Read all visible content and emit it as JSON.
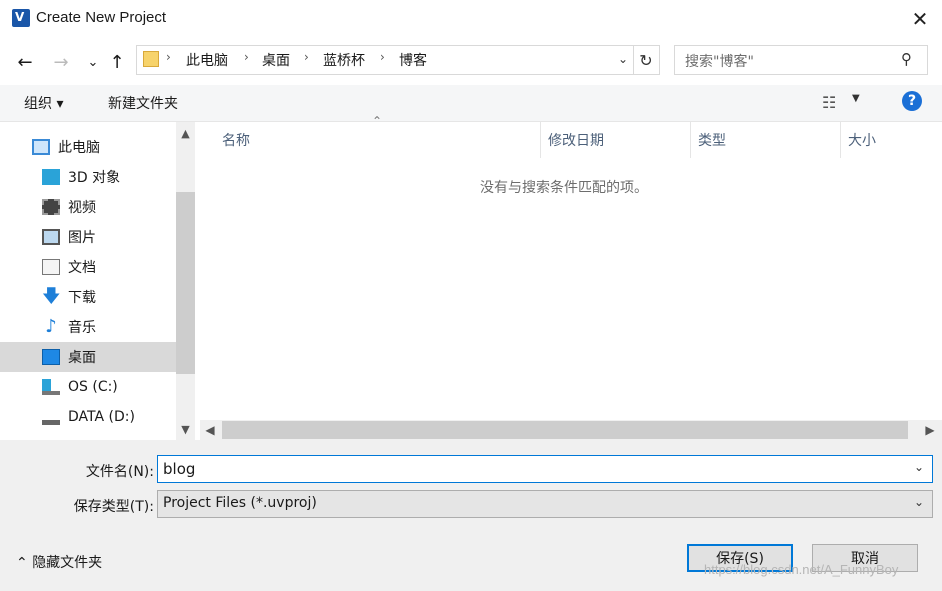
{
  "window": {
    "title": "Create New Project",
    "close": "✕"
  },
  "nav": {
    "back": "←",
    "forward": "→",
    "recent": "⌄",
    "up": "↑",
    "breadcrumb": [
      "此电脑",
      "桌面",
      "蓝桥杯",
      "博客"
    ],
    "search_placeholder": "搜索\"博客\""
  },
  "toolbar": {
    "organize": "组织 ▾",
    "new_folder": "新建文件夹",
    "help": "?"
  },
  "tree": [
    {
      "label": "此电脑",
      "icon": "computer-icon"
    },
    {
      "label": "3D 对象",
      "icon": "3d-objects-icon"
    },
    {
      "label": "视频",
      "icon": "videos-icon"
    },
    {
      "label": "图片",
      "icon": "pictures-icon"
    },
    {
      "label": "文档",
      "icon": "documents-icon"
    },
    {
      "label": "下载",
      "icon": "downloads-icon"
    },
    {
      "label": "音乐",
      "icon": "music-icon"
    },
    {
      "label": "桌面",
      "icon": "desktop-icon",
      "selected": true
    },
    {
      "label": "OS (C:)",
      "icon": "windows-drive-icon"
    },
    {
      "label": "DATA (D:)",
      "icon": "drive-icon"
    }
  ],
  "columns": [
    "名称",
    "修改日期",
    "类型",
    "大小"
  ],
  "empty_message": "没有与搜索条件匹配的项。",
  "form": {
    "filename_label": "文件名(N):",
    "filename_value": "blog",
    "filetype_label": "保存类型(T):",
    "filetype_value": "Project Files (*.uvproj)"
  },
  "footer": {
    "hide_folders": "隐藏文件夹",
    "save": "保存(S)",
    "cancel": "取消",
    "watermark": "https://blog.csdn.net/A_FunnyBoy"
  },
  "colors": {
    "accent": "#0078d7",
    "selected_bg": "#d9d9d9",
    "help": "#1a6fd6"
  }
}
